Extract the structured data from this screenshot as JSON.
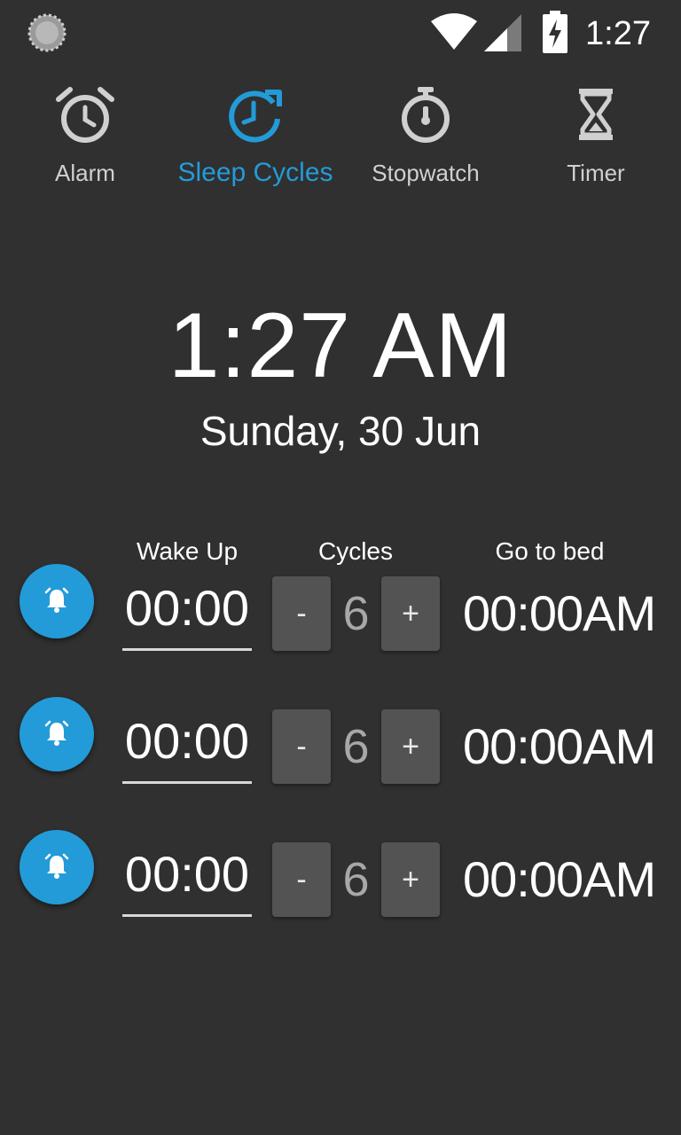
{
  "status_bar": {
    "time": "1:27",
    "icons": [
      "loading-spinner-icon",
      "wifi-icon",
      "signal-icon",
      "battery-charging-icon"
    ]
  },
  "tabs": [
    {
      "label": "Alarm",
      "icon": "alarm-clock-icon",
      "active": false
    },
    {
      "label": "Sleep Cycles",
      "icon": "sleep-cycle-icon",
      "active": true
    },
    {
      "label": "Stopwatch",
      "icon": "stopwatch-icon",
      "active": false
    },
    {
      "label": "Timer",
      "icon": "hourglass-icon",
      "active": false
    }
  ],
  "clock": {
    "time": "1:27 AM",
    "date": "Sunday, 30 Jun"
  },
  "columns": {
    "wake_up": "Wake Up",
    "cycles": "Cycles",
    "go_to_bed": "Go to bed"
  },
  "rows": [
    {
      "wake_time": "00:00",
      "minus_label": "-",
      "cycles": "6",
      "plus_label": "+",
      "bed_time": "00:00AM"
    },
    {
      "wake_time": "00:00",
      "minus_label": "-",
      "cycles": "6",
      "plus_label": "+",
      "bed_time": "00:00AM"
    },
    {
      "wake_time": "00:00",
      "minus_label": "-",
      "cycles": "6",
      "plus_label": "+",
      "bed_time": "00:00AM"
    }
  ],
  "colors": {
    "background": "#303030",
    "accent": "#239bd8",
    "tab_inactive": "#d0d0d0",
    "stepper_button": "#535353"
  }
}
